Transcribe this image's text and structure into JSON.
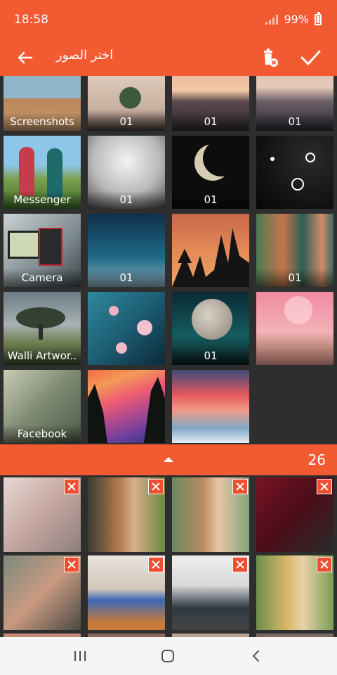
{
  "status": {
    "time": "18:58",
    "battery": "99%"
  },
  "toolbar": {
    "title": "اختر الصور",
    "back_icon": "arrow-back-icon",
    "trash_icon": "trash-clear-icon",
    "confirm_icon": "check-icon"
  },
  "colors": {
    "accent": "#f25a32",
    "background": "#2e2e2e",
    "close_badge": "#ee4e31"
  },
  "grid": {
    "labels": [
      "Screenshots",
      "01",
      "01",
      "01",
      "Messenger",
      "01",
      "01",
      "Camera",
      "01",
      "01",
      "Walli Artwor..",
      "01",
      "Facebook"
    ]
  },
  "bottom": {
    "count": "26",
    "expand_icon": "chevron-up-icon"
  },
  "selected": {
    "close_icon": "close-x-icon"
  }
}
